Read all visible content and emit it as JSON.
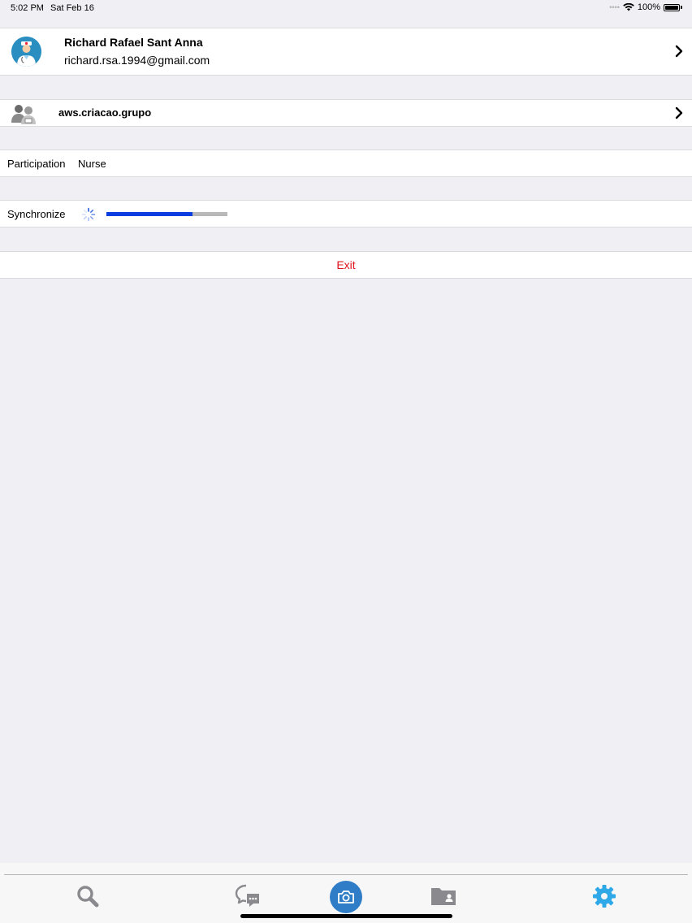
{
  "status_bar": {
    "time": "5:02 PM",
    "date": "Sat Feb 16",
    "battery": "100%",
    "wifi_icon": "wifi-icon",
    "battery_icon": "battery-icon"
  },
  "profile": {
    "name": "Richard Rafael Sant Anna",
    "email": "richard.rsa.1994@gmail.com",
    "avatar_icon": "doctor-avatar-icon"
  },
  "group": {
    "name": "aws.criacao.grupo",
    "icon": "group-people-icon"
  },
  "participation": {
    "label": "Participation",
    "value": "Nurse"
  },
  "sync": {
    "label": "Synchronize",
    "progress": 0.71,
    "colors": {
      "fill": "#0a3de0",
      "track": "#b8b8b8"
    }
  },
  "exit": {
    "label": "Exit",
    "color": "#e0151b"
  },
  "tab_bar": {
    "tabs": [
      {
        "icon": "search-icon",
        "active": false
      },
      {
        "icon": "chat-bubbles-icon",
        "active": false
      },
      {
        "icon": "camera-icon",
        "active": false
      },
      {
        "icon": "contact-folder-icon",
        "active": false
      },
      {
        "icon": "gear-icon",
        "active": true
      }
    ],
    "active_color": "#2fa8e8",
    "inactive_color": "#8a8a8e"
  }
}
